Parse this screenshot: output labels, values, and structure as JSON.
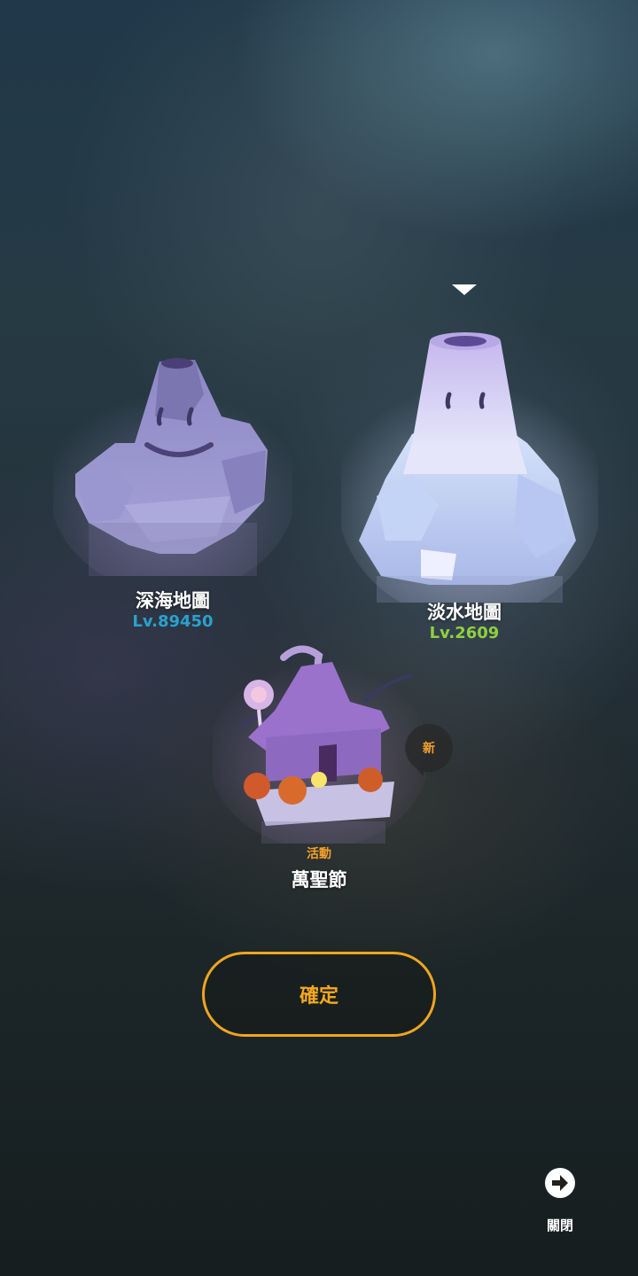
{
  "maps": [
    {
      "id": "deep-sea",
      "name": "深海地圖",
      "level": "Lv.89450",
      "level_color": "#2aa1cf",
      "selected": false
    },
    {
      "id": "freshwater",
      "name": "淡水地圖",
      "level": "Lv.2609",
      "level_color": "#8fd13f",
      "selected": true
    },
    {
      "id": "halloween",
      "name": "萬聖節",
      "tag": "活動",
      "badge": "新",
      "selected": false
    }
  ],
  "confirm_label": "確定",
  "close": {
    "label": "關閉",
    "icon": "arrow-right-circle-icon"
  },
  "colors": {
    "accent": "#f5a81f",
    "text": "#ffffff"
  }
}
